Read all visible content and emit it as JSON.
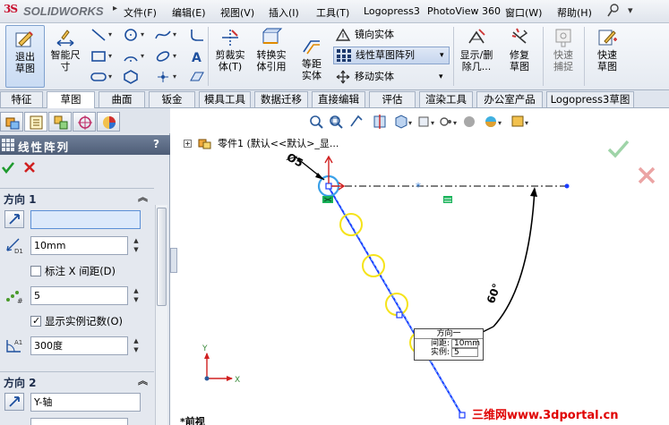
{
  "app": {
    "name": "SOLIDWORKS",
    "brand_color": "#c8102e"
  },
  "menu": {
    "items": [
      "文件(F)",
      "编辑(E)",
      "视图(V)",
      "插入(I)",
      "工具(T)",
      "Logopress3",
      "PhotoView 360",
      "窗口(W)",
      "帮助(H)"
    ]
  },
  "ribbon": {
    "exit_sketch": "退出草图",
    "smart_dimension": "智能尺寸",
    "trim": "剪裁实体(T)",
    "convert": "转换实体引用",
    "offset": "等距实体",
    "mirror": "镜向实体",
    "linear_array": "线性草图阵列",
    "move": "移动实体",
    "display_delete": "显示/删除几...",
    "repair": "修复草图",
    "quick_snap": "快速捕捉",
    "quick_sketch": "快速草图"
  },
  "tabs": [
    "特征",
    "草图",
    "曲面",
    "钣金",
    "模具工具",
    "数据迁移",
    "直接编辑",
    "评估",
    "渲染工具",
    "办公室产品",
    "Logopress3草图"
  ],
  "active_tab": "草图",
  "panel": {
    "title": "线性阵列",
    "help": "?",
    "direction1": {
      "title": "方向 1",
      "reference_value": "",
      "spacing": "10mm",
      "label_x_spacing": "标注 X 间距(D)",
      "label_x_spacing_checked": false,
      "count": "5",
      "show_count": "显示实例记数(O)",
      "show_count_checked": true,
      "angle": "300度"
    },
    "direction2": {
      "title": "方向 2",
      "reference_value": "Y-轴"
    }
  },
  "graphics": {
    "tree_label": "零件1 (默认<<默认>_显...",
    "diameter_label": "Ø5",
    "angle_label": "60°",
    "callout": {
      "title": "方向一",
      "spacing_label": "间距:",
      "spacing_value": "10mm",
      "count_label": "实例:",
      "count_value": "5"
    },
    "bottom_label": "*前视",
    "watermark": "三维网www.3dportal.cn"
  }
}
